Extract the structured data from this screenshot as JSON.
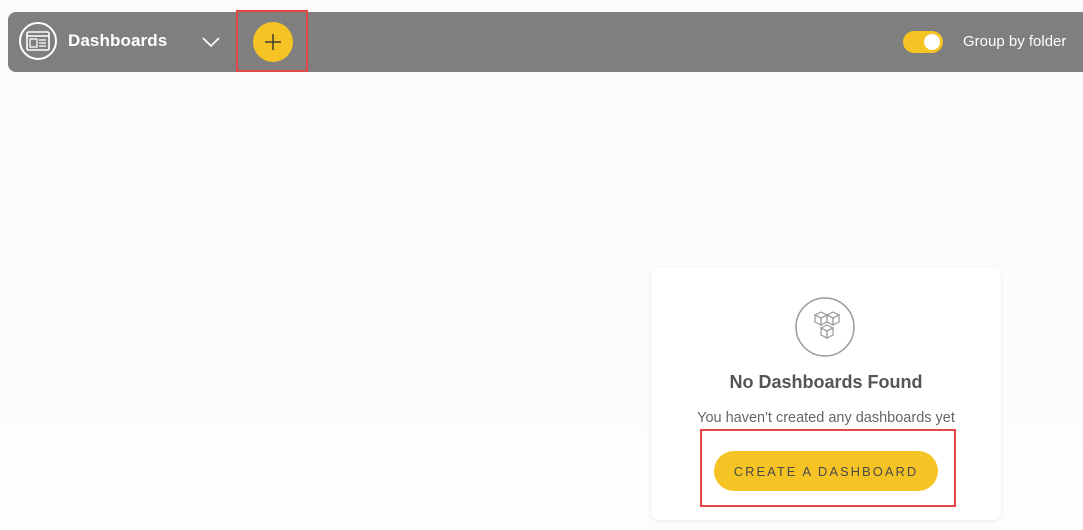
{
  "header": {
    "title": "Dashboards",
    "icons": {
      "app": "dashboard-icon",
      "dropdown": "chevron-down-icon",
      "add": "plus-icon"
    },
    "toggle": {
      "label": "Group by folder",
      "on": true
    }
  },
  "empty_state": {
    "icon": "cubes-icon",
    "title": "No Dashboards Found",
    "subtitle": "You haven't created any dashboards yet",
    "button_label": "CREATE A DASHBOARD"
  },
  "colors": {
    "topbar": "#7f7f7f",
    "accent": "#f6c325",
    "highlight": "#e04848",
    "background": "#fbfbfb"
  }
}
